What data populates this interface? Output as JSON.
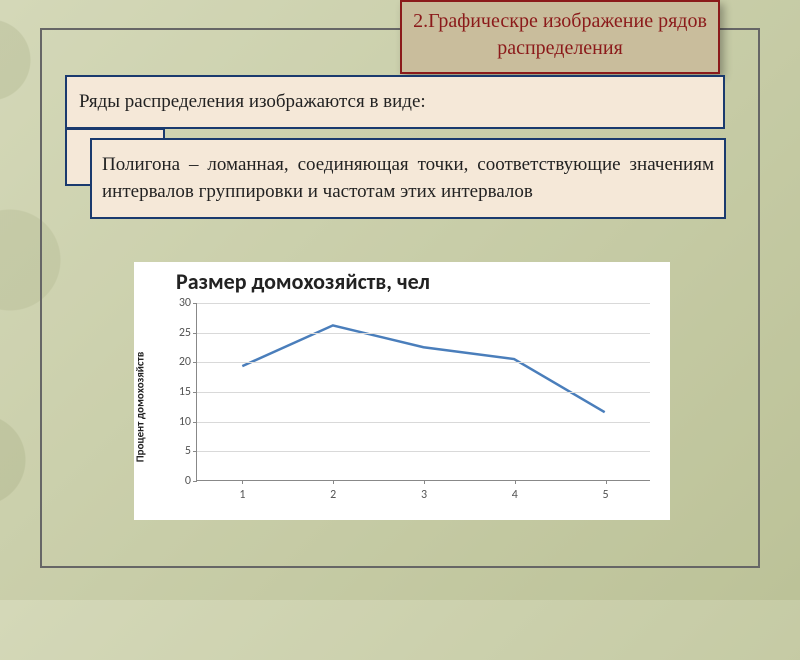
{
  "title": "2.Графическре изображение рядов распределения",
  "intro": "Ряды распределения изображаются в виде:",
  "polygon_text": "Полигона – ломанная, соединяющая точки, соответствующие значениям интервалов группировки и частотам этих интервалов",
  "chart_data": {
    "type": "line",
    "title": "Размер домохозяйств, чел",
    "ylabel": "Процент домохозяйств",
    "xlabel": "",
    "categories": [
      "1",
      "2",
      "3",
      "4",
      "5"
    ],
    "values": [
      19.3,
      26.2,
      22.5,
      20.5,
      11.5
    ],
    "ylim": [
      0,
      30
    ],
    "yticks": [
      0,
      5,
      10,
      15,
      20,
      25,
      30
    ]
  }
}
